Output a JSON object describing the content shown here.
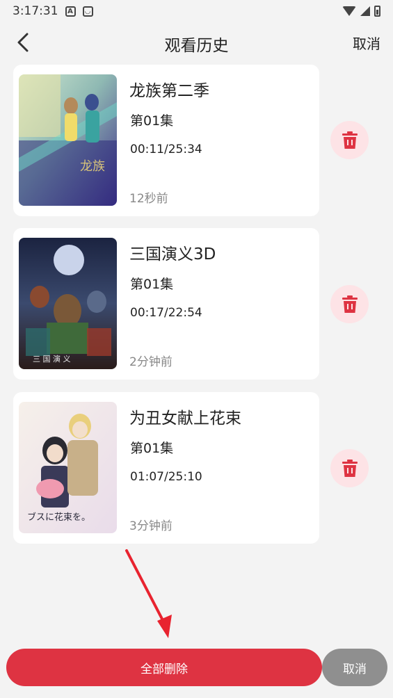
{
  "status_bar": {
    "time": "3:17:31",
    "icons": [
      "a-notification-icon",
      "cat-notification-icon",
      "wifi-icon",
      "signal-icon",
      "battery-icon"
    ]
  },
  "header": {
    "back_icon": "chevron-left-icon",
    "title": "观看历史",
    "cancel_label": "取消"
  },
  "history": [
    {
      "title": "龙族第二季",
      "episode": "第01集",
      "progress": "00:11/25:34",
      "ago": "12秒前"
    },
    {
      "title": "三国演义3D",
      "episode": "第01集",
      "progress": "00:17/22:54",
      "ago": "2分钟前"
    },
    {
      "title": "为丑女献上花束",
      "episode": "第01集",
      "progress": "01:07/25:10",
      "ago": "3分钟前"
    }
  ],
  "delete_icon": "trash-icon",
  "footer": {
    "delete_all_label": "全部删除",
    "cancel_label": "取消"
  },
  "colors": {
    "accent": "#de3342",
    "delete_bg": "#fde3e6",
    "cancel_bg": "#8f8f8f",
    "page_bg": "#f3f3f3",
    "annotation_arrow": "#e8232f"
  }
}
